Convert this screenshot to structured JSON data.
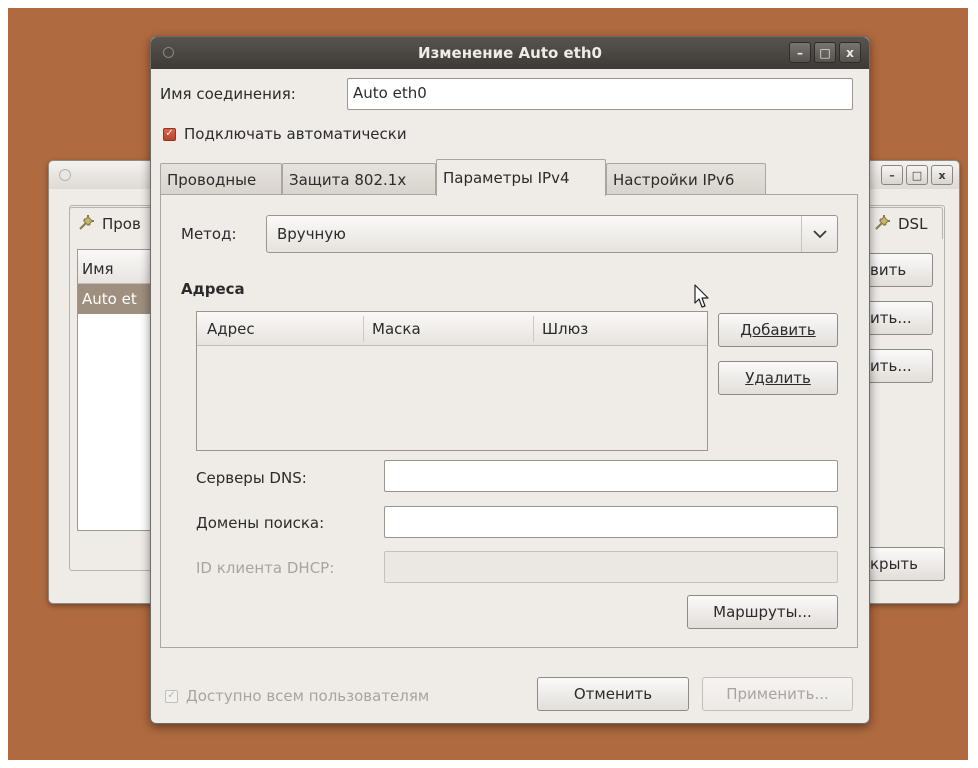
{
  "background_window": {
    "tab_label": "Пров",
    "tab_right_label": "DSL",
    "list_header": "Имя",
    "list_row": "Auto et",
    "btn_add": "вить",
    "btn_edit": "ить...",
    "btn_delete": "ить...",
    "btn_close": "крыть",
    "ctrl_min": "–",
    "ctrl_max": "□",
    "ctrl_close": "x"
  },
  "dialog": {
    "title": "Изменение Auto eth0",
    "ctrl_min": "–",
    "ctrl_max": "□",
    "ctrl_close": "x",
    "connection_name_label": "Имя соединения:",
    "connection_name_value": "Auto eth0",
    "auto_connect_label": "Подключать автоматически",
    "auto_connect_checked": true,
    "tabs": [
      {
        "label": "Проводные",
        "active": false
      },
      {
        "label": "Защита 802.1x",
        "active": false
      },
      {
        "label": "Параметры IPv4",
        "active": true
      },
      {
        "label": "Настройки IPv6",
        "active": false
      }
    ],
    "method_label": "Метод:",
    "method_value": "Вручную",
    "addresses_heading": "Адреса",
    "addresses_columns": [
      "Адрес",
      "Маска",
      "Шлюз"
    ],
    "add_button": "Добавить",
    "delete_button": "Удалить",
    "dns_label": "Серверы DNS:",
    "dns_value": "",
    "search_domains_label": "Домены поиска:",
    "search_domains_value": "",
    "dhcp_client_id_label": "ID клиента DHCP:",
    "dhcp_client_id_value": "",
    "routes_button": "Маршруты...",
    "available_all_users_label": "Доступно всем пользователям",
    "available_all_users_checked": true,
    "cancel_button": "Отменить",
    "apply_button": "Применить..."
  },
  "colors": {
    "desktop": "#b06a3f",
    "window_bg": "#efebe7",
    "titlebar": "#3d3a37",
    "checkbox_accent": "#c8543a"
  }
}
